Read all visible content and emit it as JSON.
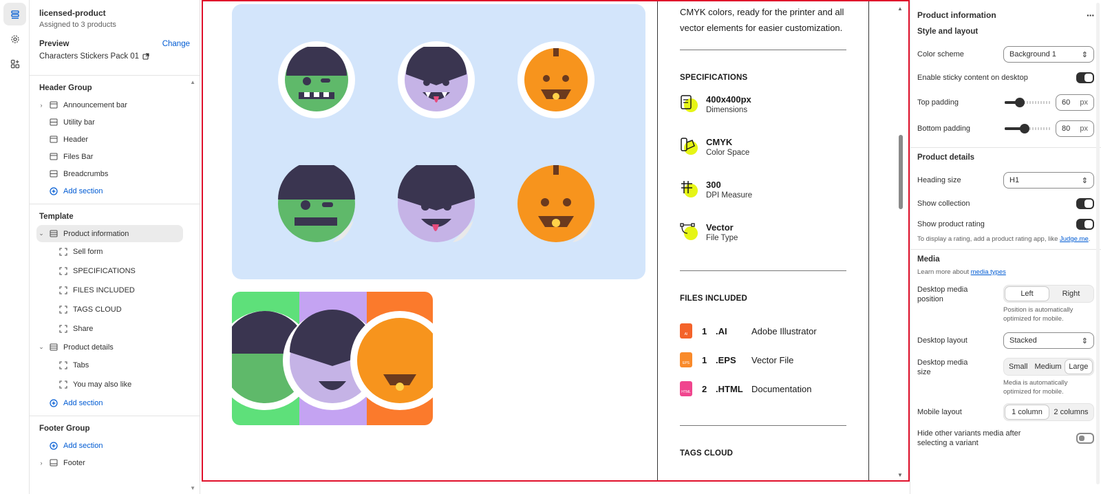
{
  "left_panel": {
    "title": "licensed-product",
    "subtitle": "Assigned to 3 products",
    "preview_label": "Preview",
    "change_label": "Change",
    "preview_name": "Characters Stickers Pack 01",
    "header_group": {
      "title": "Header Group",
      "items": [
        "Announcement bar",
        "Utility bar",
        "Header",
        "Files Bar",
        "Breadcrumbs"
      ],
      "add": "Add section"
    },
    "template": {
      "title": "Template",
      "product_information": "Product information",
      "pi_children": [
        "Sell form",
        "SPECIFICATIONS",
        "FILES INCLUDED",
        "TAGS CLOUD",
        "Share"
      ],
      "product_details": "Product details",
      "pd_children": [
        "Tabs",
        "You may also like"
      ],
      "add": "Add section"
    },
    "footer_group": {
      "title": "Footer Group",
      "add": "Add section",
      "footer": "Footer"
    }
  },
  "preview": {
    "intro": "CMYK colors, ready for the printer and all vector elements for easier customization.",
    "specs_title": "SPECIFICATIONS",
    "specs": [
      {
        "value": "400x400px",
        "label": "Dimensions",
        "icon": "file-dimension-icon"
      },
      {
        "value": "CMYK",
        "label": "Color Space",
        "icon": "color-palette-icon"
      },
      {
        "value": "300",
        "label": "DPI Measure",
        "icon": "grid-icon"
      },
      {
        "value": "Vector",
        "label": "File Type",
        "icon": "vector-pen-icon"
      }
    ],
    "files_title": "FILES INCLUDED",
    "files": [
      {
        "count": "1",
        "ext": ".AI",
        "desc": "Adobe Illustrator",
        "badge": "AI",
        "color": "#f4632a"
      },
      {
        "count": "1",
        "ext": ".EPS",
        "desc": "Vector File",
        "badge": "EPS",
        "color": "#f98a2a"
      },
      {
        "count": "2",
        "ext": ".HTML",
        "desc": "Documentation",
        "badge": "HTML",
        "color": "#f0458e"
      }
    ],
    "tags_title": "TAGS CLOUD",
    "colors": {
      "gallery_bg": "#d3e5fb",
      "accent_dot": "#e6f516"
    }
  },
  "right_panel": {
    "title": "Product information",
    "more": "···",
    "style_layout": "Style and layout",
    "color_scheme_label": "Color scheme",
    "color_scheme_value": "Background 1",
    "sticky_label": "Enable sticky content on desktop",
    "top_padding_label": "Top padding",
    "top_padding_value": "60",
    "bottom_padding_label": "Bottom padding",
    "bottom_padding_value": "80",
    "px": "px",
    "product_details": "Product details",
    "heading_size_label": "Heading size",
    "heading_size_value": "H1",
    "show_collection_label": "Show collection",
    "show_rating_label": "Show product rating",
    "rating_note_prefix": "To display a rating, add a product rating app, like ",
    "rating_note_link": "Judge.me",
    "rating_note_suffix": ".",
    "media": "Media",
    "media_note_prefix": "Learn more about ",
    "media_note_link": "media types",
    "desktop_media_position_label": "Desktop media position",
    "position_options": [
      "Left",
      "Right"
    ],
    "position_note": "Position is automatically optimized for mobile.",
    "desktop_layout_label": "Desktop layout",
    "desktop_layout_value": "Stacked",
    "desktop_media_size_label": "Desktop media size",
    "size_options": [
      "Small",
      "Medium",
      "Large"
    ],
    "size_note": "Media is automatically optimized for mobile.",
    "mobile_layout_label": "Mobile layout",
    "mobile_options": [
      "1 column",
      "2 columns"
    ],
    "hide_variants_label": "Hide other variants media after selecting a variant"
  }
}
